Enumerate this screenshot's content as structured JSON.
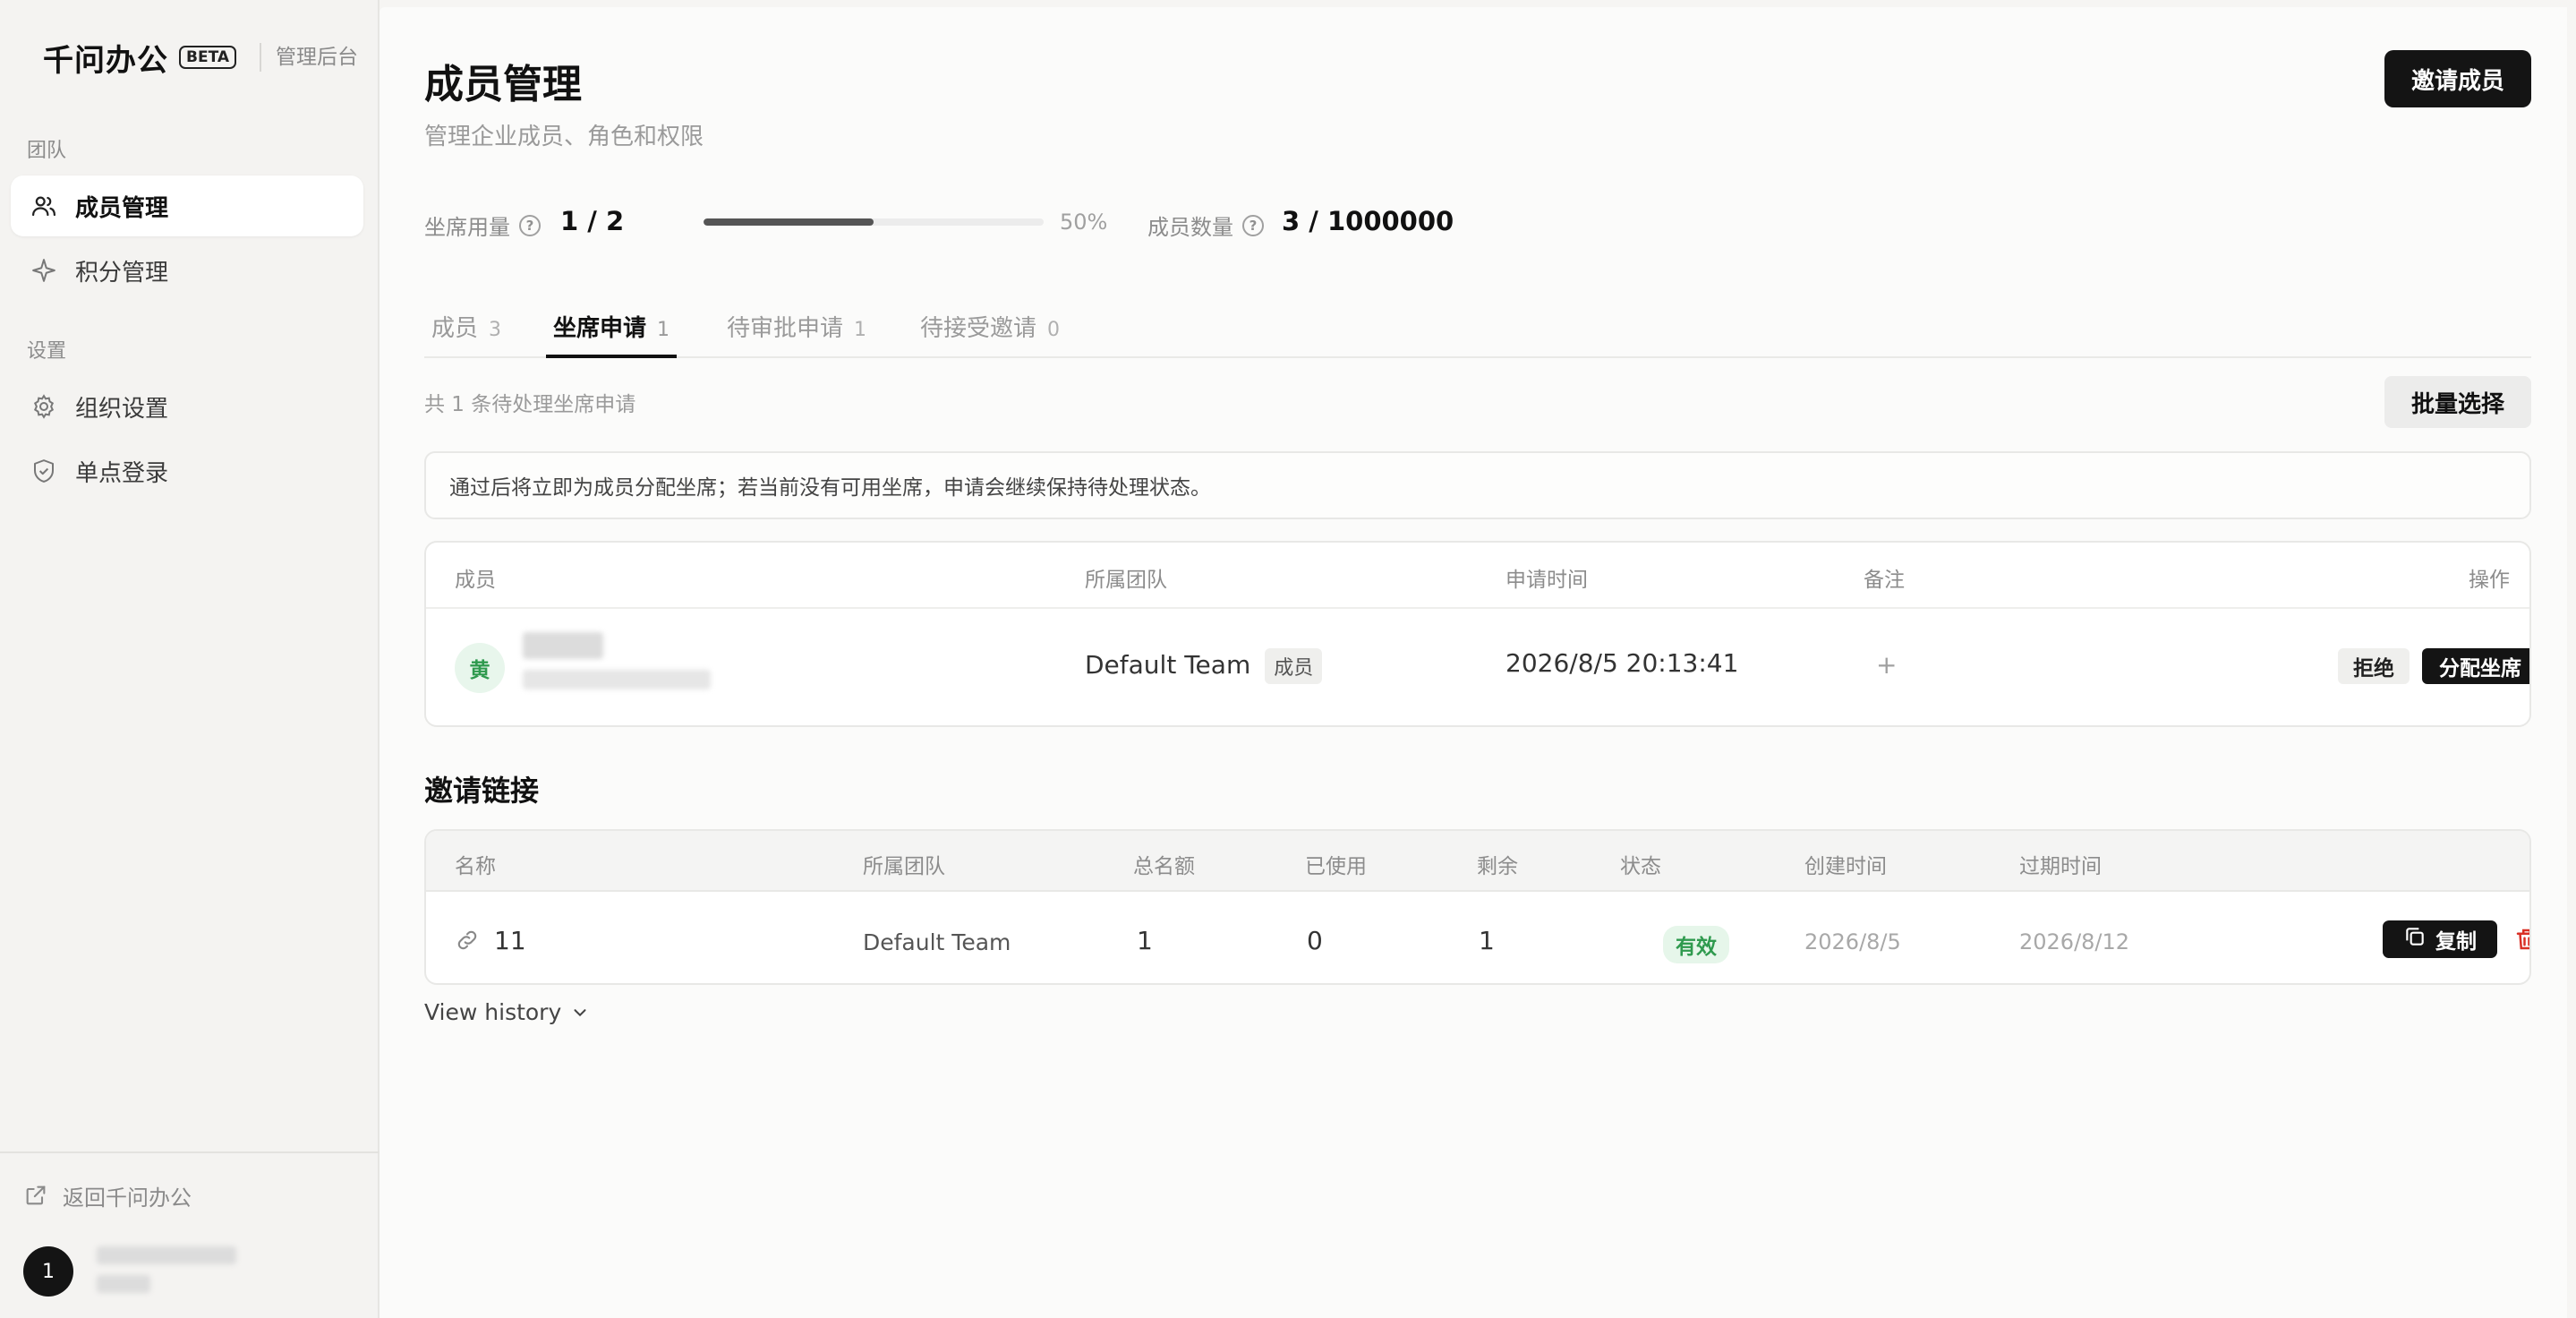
{
  "brand": {
    "name": "千问办公",
    "badge": "BETA",
    "admin_label": "管理后台"
  },
  "sidebar": {
    "groups": [
      {
        "label": "团队",
        "items": [
          {
            "label": "成员管理",
            "icon": "users-icon",
            "active": true
          },
          {
            "label": "积分管理",
            "icon": "sparkle-icon",
            "active": false
          }
        ]
      },
      {
        "label": "设置",
        "items": [
          {
            "label": "组织设置",
            "icon": "gear-icon",
            "active": false
          },
          {
            "label": "单点登录",
            "icon": "shield-icon",
            "active": false
          }
        ]
      }
    ],
    "back_link": "返回千问办公",
    "user_avatar": "1"
  },
  "header": {
    "title": "成员管理",
    "subtitle": "管理企业成员、角色和权限",
    "invite_button": "邀请成员"
  },
  "stats": {
    "seat_label": "坐席用量",
    "seat_value": "1 / 2",
    "seat_progress_percent": 50,
    "seat_percent_label": "50%",
    "member_label": "成员数量",
    "member_value": "3 / 1000000"
  },
  "tabs": [
    {
      "label": "成员",
      "count": "3",
      "active": false
    },
    {
      "label": "坐席申请",
      "count": "1",
      "active": true
    },
    {
      "label": "待审批申请",
      "count": "1",
      "active": false
    },
    {
      "label": "待接受邀请",
      "count": "0",
      "active": false
    }
  ],
  "pending": {
    "summary": "共 1 条待处理坐席申请",
    "batch_button": "批量选择",
    "notice": "通过后将立即为成员分配坐席；若当前没有可用坐席，申请会继续保持待处理状态。"
  },
  "request_table": {
    "headers": [
      "成员",
      "所属团队",
      "申请时间",
      "备注",
      "操作"
    ],
    "rows": [
      {
        "avatar": "黄",
        "team": "Default Team",
        "role": "成员",
        "time": "2026/8/5 20:13:41",
        "note": "+",
        "reject": "拒绝",
        "assign": "分配坐席"
      }
    ]
  },
  "invite_links": {
    "title": "邀请链接",
    "headers": [
      "名称",
      "所属团队",
      "总名额",
      "已使用",
      "剩余",
      "状态",
      "创建时间",
      "过期时间"
    ],
    "rows": [
      {
        "name": "11",
        "team": "Default Team",
        "total": "1",
        "used": "0",
        "remaining": "1",
        "status": "有效",
        "created": "2026/8/5",
        "expires": "2026/8/12",
        "copy": "复制"
      }
    ],
    "view_history": "View history"
  },
  "colors": {
    "accent_dark": "#141414",
    "success_green": "#2f9a4e",
    "danger_red": "#d93025"
  }
}
